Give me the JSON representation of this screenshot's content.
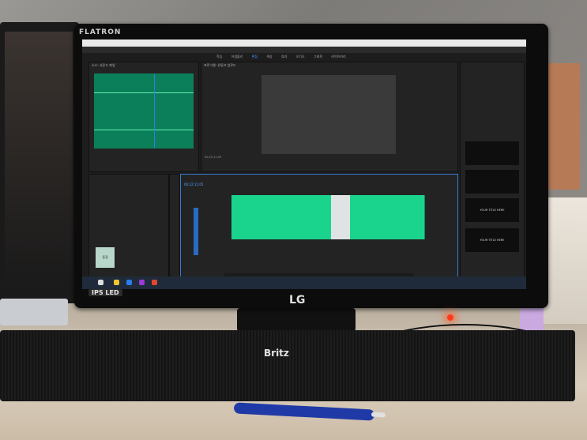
{
  "monitor": {
    "brand": "FLATRON",
    "panel_badge": "IPS LED",
    "logo": "LG"
  },
  "speaker": {
    "brand": "Britz"
  },
  "app": {
    "workspace_tabs": [
      "학습",
      "어셈블리",
      "편집",
      "색상",
      "효과",
      "오디오",
      "그래픽",
      "라이브러리"
    ],
    "active_tab_index": 2,
    "program_label": "프로그램: 유튜브 업로드",
    "source_label": "소스: 사운드 파일",
    "timeline_label": "유튜브 업로드",
    "timecode": "00;22;11;05",
    "nested_label": "중첩",
    "title_cards": [
      "YOUR TITLE HERE",
      "YOUR TITLE HERE"
    ]
  },
  "colors": {
    "waveform": "#0b7f59",
    "clip": "#1ad48e",
    "accent": "#4ea1ff",
    "led": "#ff3a1a"
  }
}
